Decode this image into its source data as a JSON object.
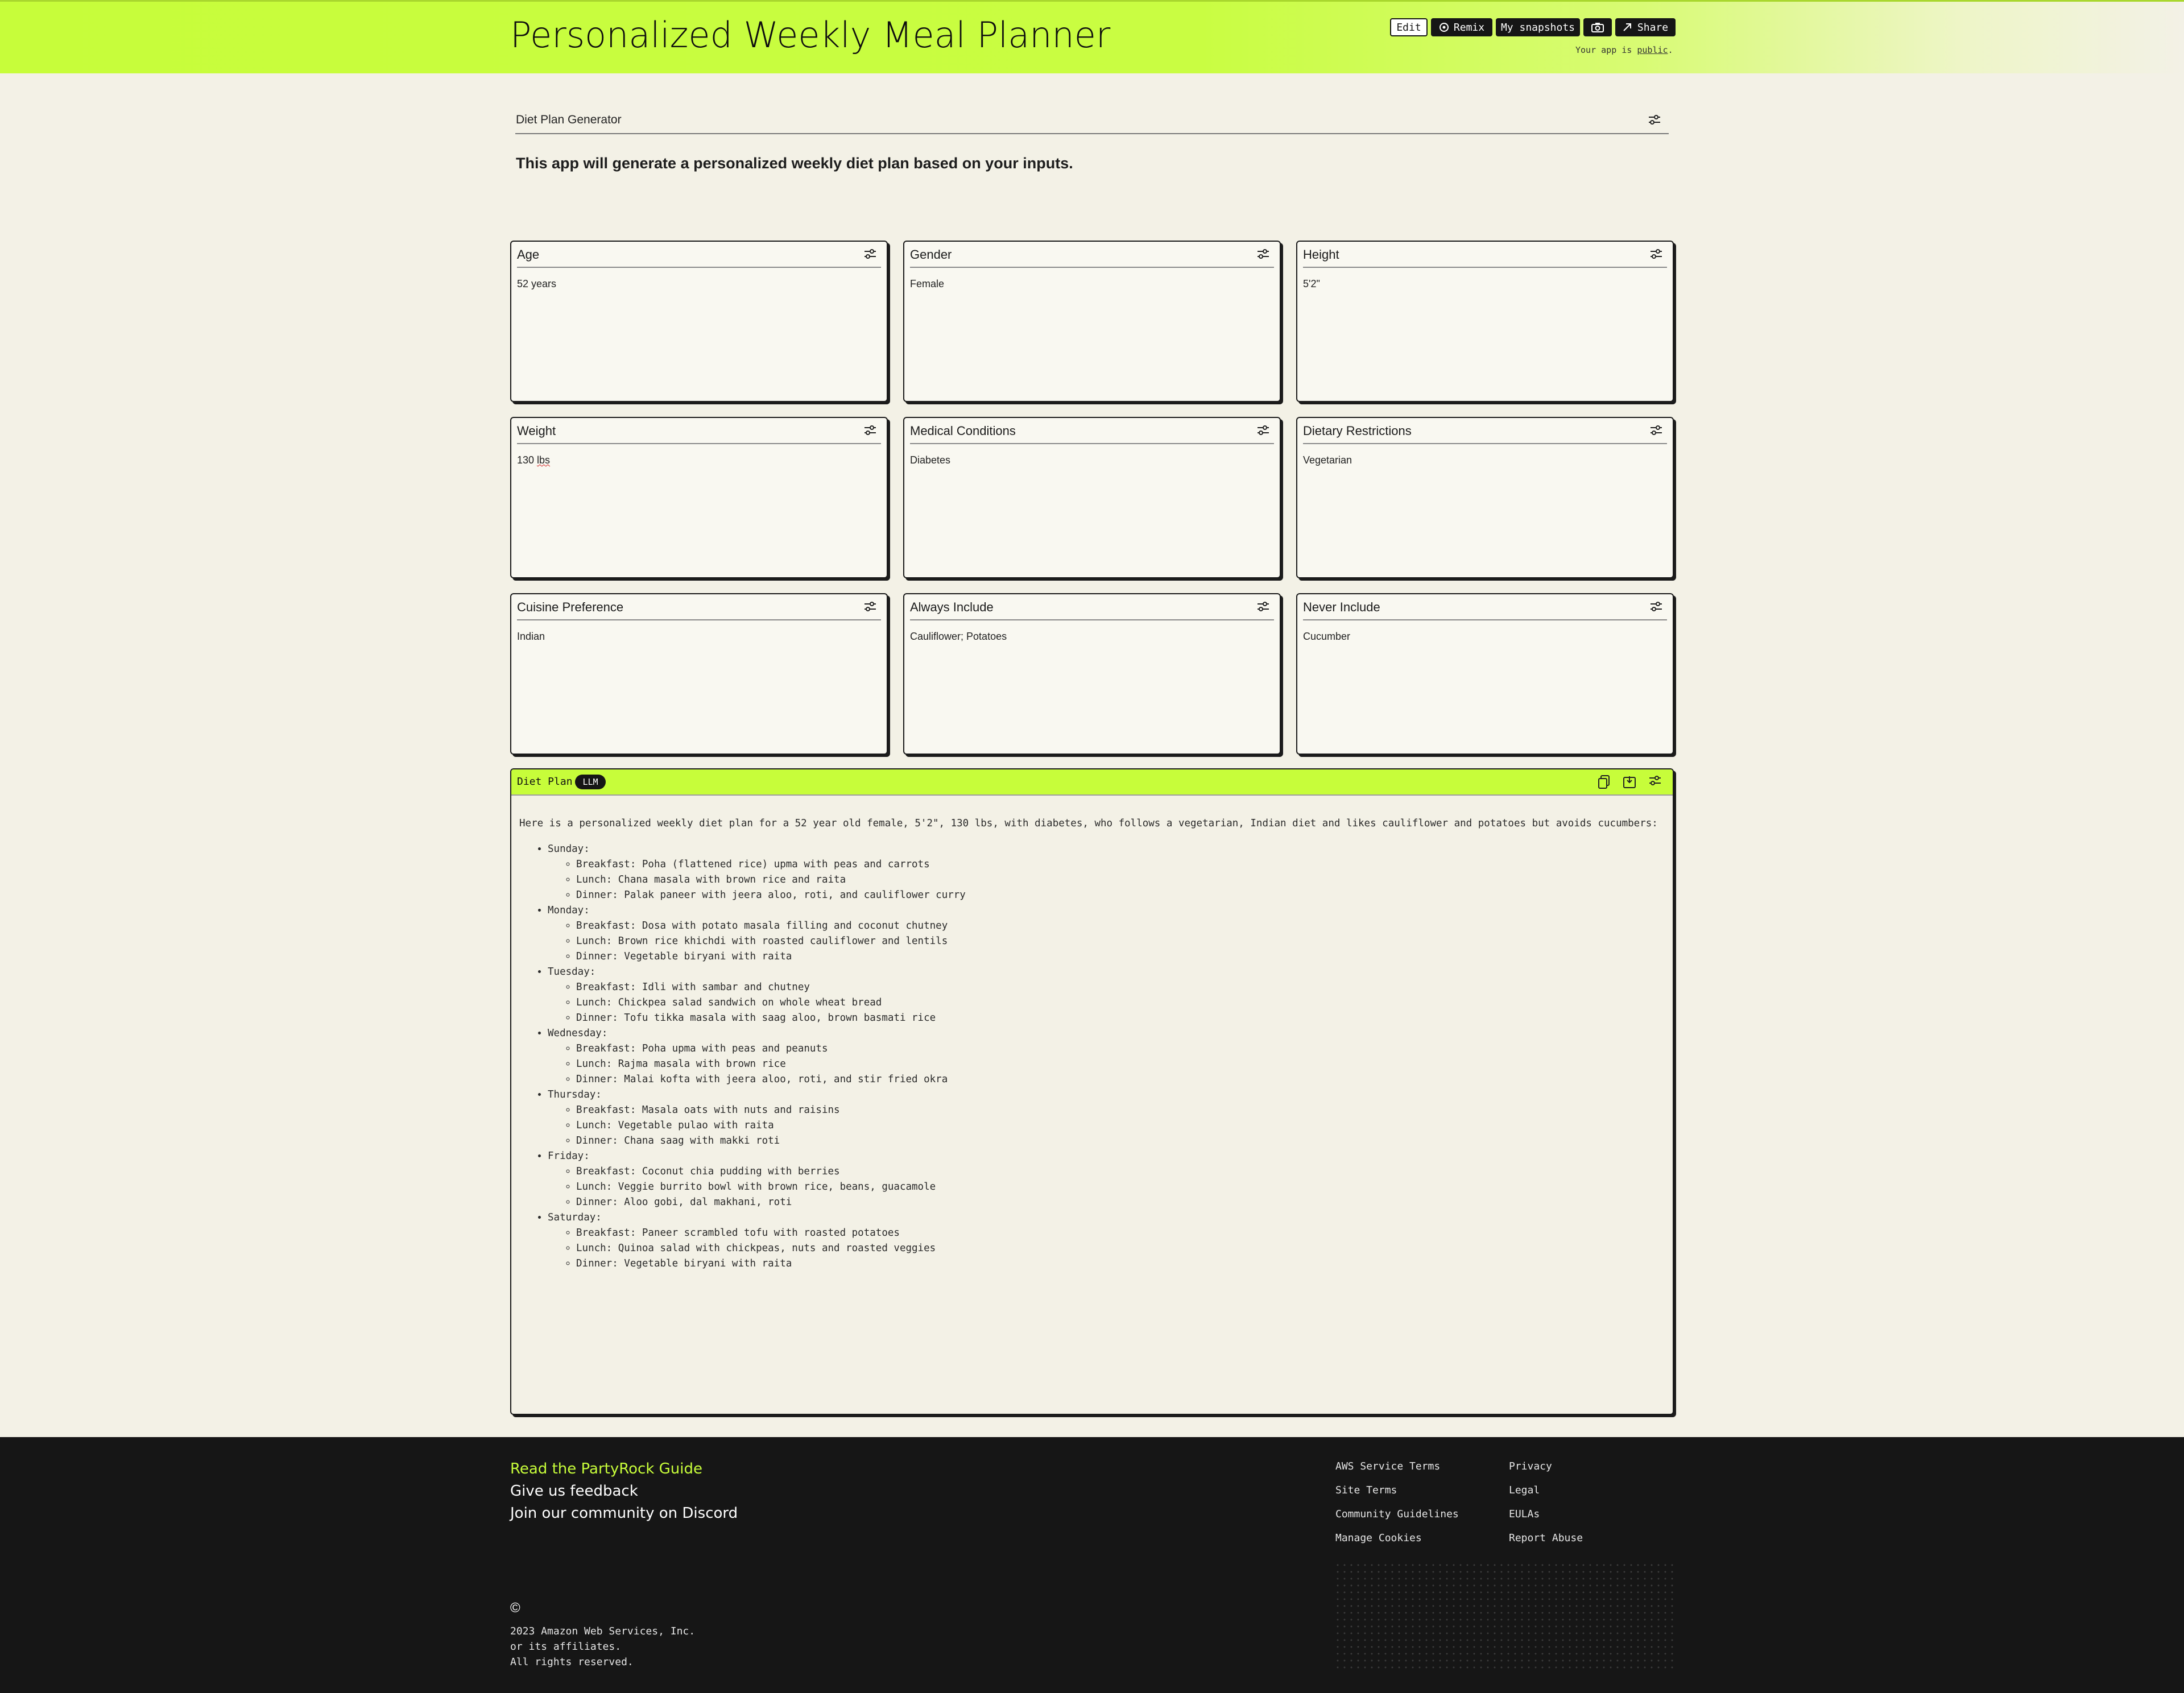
{
  "header": {
    "title": "Personalized Weekly Meal Planner",
    "buttons": {
      "edit": "Edit",
      "remix": "Remix",
      "snapshots": "My snapshots",
      "share": "Share"
    },
    "public_prefix": "Your app is ",
    "public_link": "public",
    "public_suffix": "."
  },
  "intro": {
    "label": "Diet Plan Generator",
    "text": "This app will generate a personalized weekly diet plan based on your inputs."
  },
  "cards": [
    {
      "title": "Age",
      "value": "52 years"
    },
    {
      "title": "Gender",
      "value": "Female"
    },
    {
      "title": "Height",
      "value": "5'2\""
    },
    {
      "title": "Weight",
      "value_num": "130 ",
      "value_unit": "lbs"
    },
    {
      "title": "Medical Conditions",
      "value": "Diabetes"
    },
    {
      "title": "Dietary Restrictions",
      "value": "Vegetarian"
    },
    {
      "title": "Cuisine Preference",
      "value": "Indian"
    },
    {
      "title": "Always Include",
      "value": "Cauliflower; Potatoes"
    },
    {
      "title": "Never Include",
      "value": "Cucumber"
    }
  ],
  "plan": {
    "title": "Diet Plan",
    "badge": "LLM",
    "intro": "Here is a personalized weekly diet plan for a 52 year old female, 5'2\", 130 lbs, with diabetes, who follows a vegetarian, Indian diet and likes cauliflower and potatoes but avoids cucumbers:",
    "days": [
      {
        "day": "Sunday:",
        "meals": [
          "Breakfast: Poha (flattened rice) upma with peas and carrots",
          "Lunch: Chana masala with brown rice and raita",
          "Dinner: Palak paneer with jeera aloo, roti, and cauliflower curry"
        ]
      },
      {
        "day": "Monday:",
        "meals": [
          "Breakfast: Dosa with potato masala filling and coconut chutney",
          "Lunch: Brown rice khichdi with roasted cauliflower and lentils",
          "Dinner: Vegetable biryani with raita"
        ]
      },
      {
        "day": "Tuesday:",
        "meals": [
          "Breakfast: Idli with sambar and chutney",
          "Lunch: Chickpea salad sandwich on whole wheat bread",
          "Dinner: Tofu tikka masala with saag aloo, brown basmati rice"
        ]
      },
      {
        "day": "Wednesday:",
        "meals": [
          "Breakfast: Poha upma with peas and peanuts",
          "Lunch: Rajma masala with brown rice",
          "Dinner: Malai kofta with jeera aloo, roti, and stir fried okra"
        ]
      },
      {
        "day": "Thursday:",
        "meals": [
          "Breakfast: Masala oats with nuts and raisins",
          "Lunch: Vegetable pulao with raita",
          "Dinner: Chana saag with makki roti"
        ]
      },
      {
        "day": "Friday:",
        "meals": [
          "Breakfast: Coconut chia pudding with berries",
          "Lunch: Veggie burrito bowl with brown rice, beans, guacamole",
          "Dinner: Aloo gobi, dal makhani, roti"
        ]
      },
      {
        "day": "Saturday:",
        "meals": [
          "Breakfast: Paneer scrambled tofu with roasted potatoes",
          "Lunch: Quinoa salad with chickpeas, nuts and roasted veggies",
          "Dinner: Vegetable biryani with raita"
        ]
      }
    ]
  },
  "footer": {
    "guide": "Read the PartyRock Guide",
    "feedback": "Give us feedback",
    "discord": "Join our community on Discord",
    "links_col1": [
      "AWS Service Terms",
      "Site Terms",
      "Community Guidelines",
      "Manage Cookies"
    ],
    "links_col2": [
      "Privacy",
      "Legal",
      "EULAs",
      "Report Abuse"
    ],
    "copyright_symbol": "©",
    "copyright_lines": [
      "2023 Amazon Web Services, Inc.",
      "or its affiliates.",
      "All rights reserved."
    ]
  },
  "colors": {
    "accent": "#c7fd3a",
    "background": "#f3f1e6",
    "dark": "#161616"
  },
  "icons": {
    "settings": "sliders-icon",
    "remix": "remix-icon",
    "camera": "camera-icon",
    "share": "arrow-right-icon",
    "copy": "copy-icon",
    "save": "save-icon"
  }
}
